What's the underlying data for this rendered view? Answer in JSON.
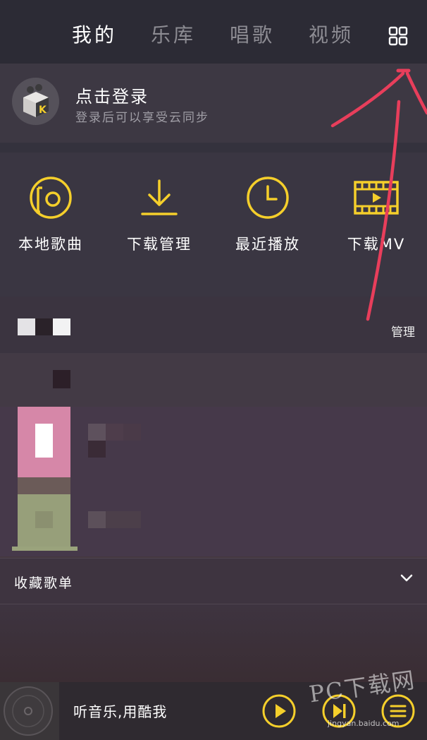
{
  "tabs": [
    "我的",
    "乐库",
    "唱歌",
    "视频"
  ],
  "login": {
    "title": "点击登录",
    "subtitle": "登录后可以享受云同步"
  },
  "quick": [
    {
      "label": "本地歌曲",
      "icon": "disc-icon"
    },
    {
      "label": "下载管理",
      "icon": "download-icon"
    },
    {
      "label": "最近播放",
      "icon": "clock-icon"
    },
    {
      "label": "下载MV",
      "icon": "film-icon"
    }
  ],
  "playlist": {
    "manage": "管理"
  },
  "favorites": {
    "label": "收藏歌单"
  },
  "player": {
    "now_playing": "听音乐,用酷我"
  },
  "watermark": {
    "text": "PC下载网",
    "sub": "jingyan.baidu.com"
  },
  "colors": {
    "accent": "#f5cf2b",
    "annotation": "#e83e5b"
  }
}
